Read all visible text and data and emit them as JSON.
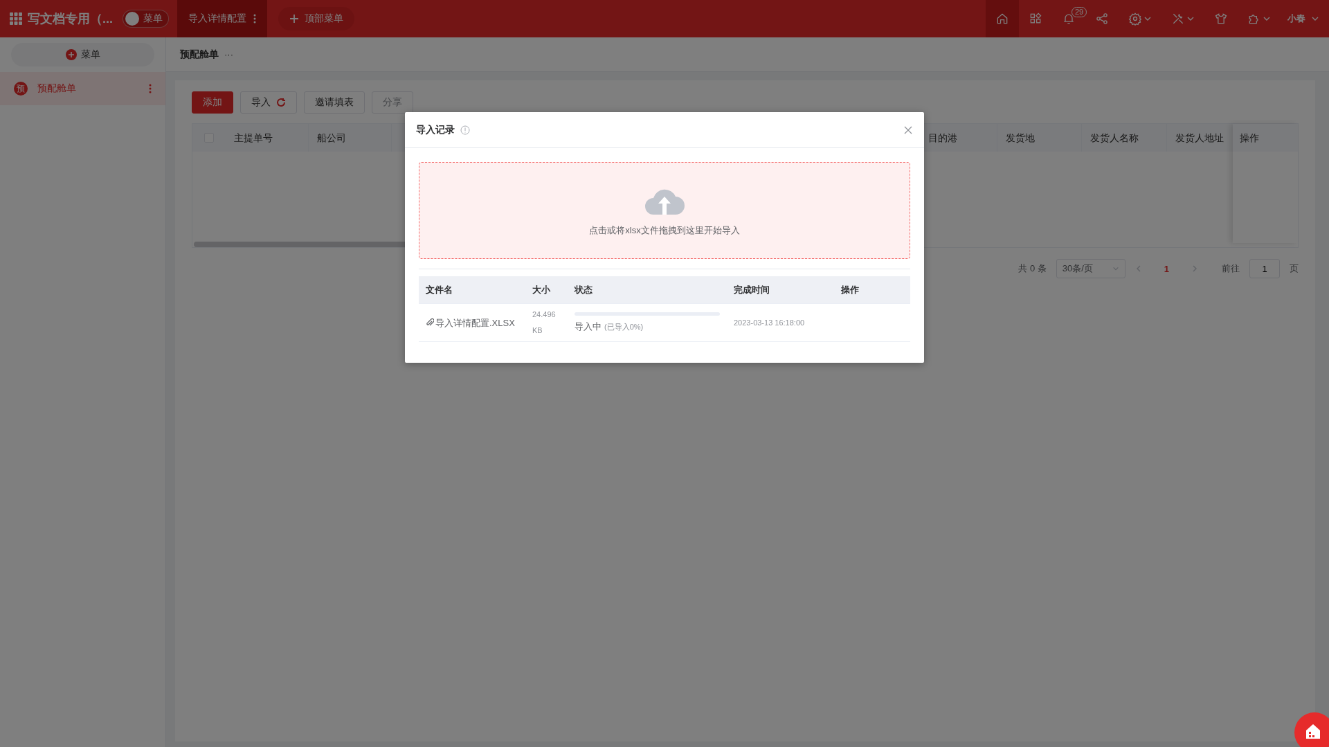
{
  "top_bar": {
    "title": "写文档专用（...",
    "menu_toggle": {
      "label": "菜单",
      "on": false
    },
    "tabs": [
      {
        "label": "导入详情配置",
        "selected": true
      }
    ],
    "add_menu": "顶部菜单",
    "tools": [
      {
        "kind": "home",
        "selected": true
      },
      {
        "kind": "apps",
        "selected": false
      },
      {
        "kind": "bell",
        "selected": false,
        "badge": "29"
      },
      {
        "kind": "share",
        "selected": false
      },
      {
        "kind": "gear",
        "selected": false,
        "dropdown": true
      },
      {
        "kind": "tools",
        "selected": false,
        "dropdown": true
      },
      {
        "kind": "shirt",
        "selected": false
      },
      {
        "kind": "puzzle",
        "selected": false,
        "dropdown": true
      }
    ],
    "user": "小春"
  },
  "sidebar": {
    "add_button": "菜单",
    "items": [
      {
        "badge": "预",
        "label": "预配舱单",
        "selected": true
      }
    ]
  },
  "breadcrumb": {
    "label": "预配舱单",
    "more": "···"
  },
  "toolbar": [
    {
      "label": "添加",
      "kind": "primary",
      "disabled": false
    },
    {
      "label": "导入",
      "kind": "refresh",
      "disabled": false
    },
    {
      "label": "邀请填表",
      "kind": "plain",
      "disabled": false
    },
    {
      "label": "分享",
      "kind": "plain",
      "disabled": true
    }
  ],
  "table": {
    "select_all": {
      "checked": false
    },
    "columns": [
      "主提单号",
      "船公司",
      "目的港",
      "发货地",
      "发货人名称",
      "发货人地址"
    ],
    "action_column": "操作"
  },
  "pagination": {
    "total": "共 0 条",
    "page_size": "30条/页",
    "pages": [
      {
        "label": "1",
        "selected": true
      }
    ],
    "goto_label": "前往",
    "goto_value": "1",
    "goto_suffix": "页"
  },
  "dialog": {
    "title": "导入记录",
    "upload_hint": "点击或将xlsx文件拖拽到这里开始导入",
    "columns": [
      "文件名",
      "大小",
      "状态",
      "完成时间",
      "操作"
    ],
    "rows": [
      {
        "file": "导入详情配置.XLSX",
        "size": "24.496 KB",
        "status": "导入中",
        "progress_text": "(已导入0%)",
        "level": 0,
        "time": "2023-03-13 16:18:00"
      }
    ]
  }
}
